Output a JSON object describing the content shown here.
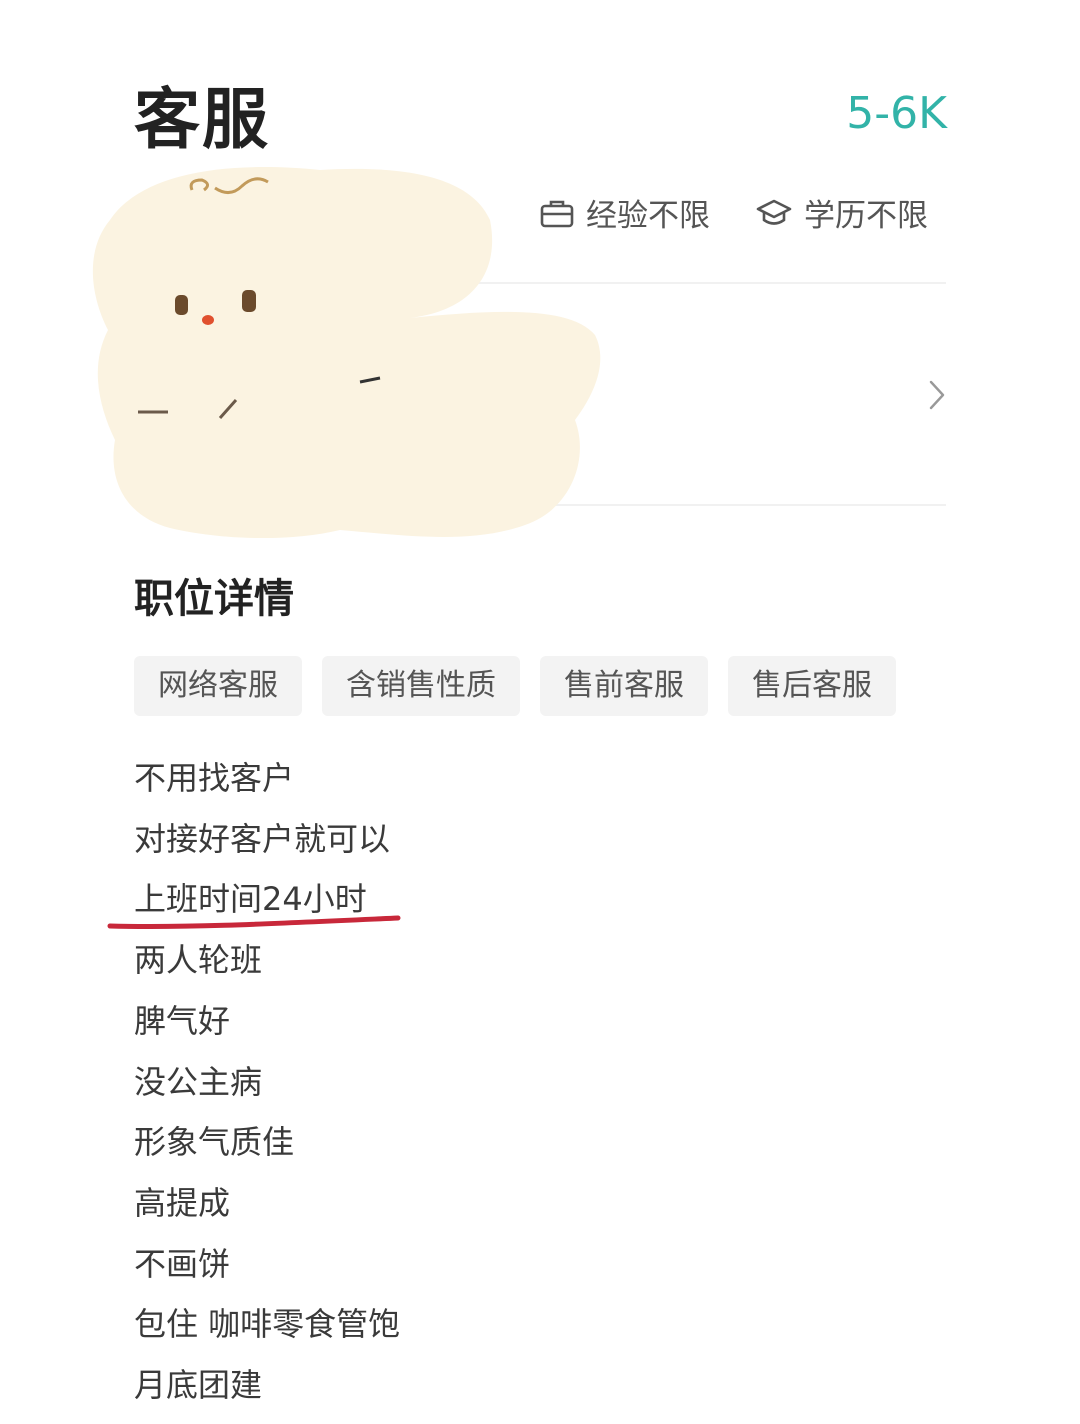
{
  "job": {
    "title": "客服",
    "salary": "5-6K"
  },
  "requirements": {
    "experience": "经验不限",
    "education": "学历不限"
  },
  "section": {
    "title": "职位详情"
  },
  "tags": [
    "网络客服",
    "含销售性质",
    "售前客服",
    "售后客服"
  ],
  "description": [
    "不用找客户",
    "对接好客户就可以",
    "上班时间24小时",
    "两人轮班",
    "脾气好",
    "没公主病",
    "形象气质佳",
    "高提成",
    "不画饼",
    "包住 咖啡零食管饱",
    "月底团建"
  ],
  "colors": {
    "salary": "#32b3a8",
    "annotation_underline": "#c8283a",
    "sticker": "#fbf3e1",
    "tag_bg": "#f3f3f3"
  },
  "icons": {
    "experience": "briefcase-icon",
    "education": "graduation-cap-icon",
    "arrow": "chevron-right-icon"
  }
}
